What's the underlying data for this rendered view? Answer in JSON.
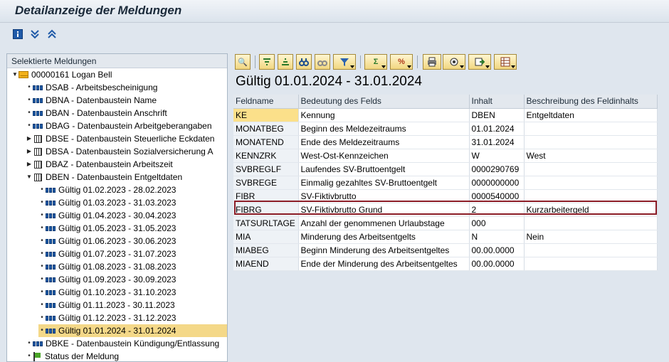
{
  "window": {
    "title": "Detailanzeige der Meldungen"
  },
  "app_toolbar": {
    "icons": [
      "info-icon",
      "expand-all-icon",
      "collapse-all-icon"
    ]
  },
  "tree": {
    "header": "Selektierte Meldungen",
    "root": "00000161 Logan Bell",
    "items": [
      {
        "label": "DSAB - Arbeitsbescheinigung",
        "icon": "record-icon"
      },
      {
        "label": "DBNA - Datenbaustein Name",
        "icon": "record-icon"
      },
      {
        "label": "DBAN - Datenbaustein Anschrift",
        "icon": "record-icon"
      },
      {
        "label": "DBAG - Datenbaustein Arbeitgeberangaben",
        "icon": "record-icon"
      },
      {
        "label": "DBSE - Datenbaustein Steuerliche Eckdaten",
        "icon": "table-icon"
      },
      {
        "label": "DBSA - Datenbaustein Sozialversicherung A",
        "icon": "table-icon"
      },
      {
        "label": "DBAZ - Datenbaustein Arbeitszeit",
        "icon": "table-icon"
      },
      {
        "label": "DBEN - Datenbaustein Entgeltdaten",
        "icon": "table-icon"
      }
    ],
    "periods": [
      "Gültig 01.02.2023 - 28.02.2023",
      "Gültig 01.03.2023 - 31.03.2023",
      "Gültig 01.04.2023 - 30.04.2023",
      "Gültig 01.05.2023 - 31.05.2023",
      "Gültig 01.06.2023 - 30.06.2023",
      "Gültig 01.07.2023 - 31.07.2023",
      "Gültig 01.08.2023 - 31.08.2023",
      "Gültig 01.09.2023 - 30.09.2023",
      "Gültig 01.10.2023 - 31.10.2023",
      "Gültig 01.11.2023 - 30.11.2023",
      "Gültig 01.12.2023 - 31.12.2023",
      "Gültig 01.01.2024 - 31.01.2024"
    ],
    "after": [
      {
        "label": "DBKE - Datenbaustein Kündigung/Entlassung",
        "icon": "record-icon"
      },
      {
        "label": "Status der Meldung",
        "icon": "flag-icon"
      }
    ],
    "selected_period": "Gültig 01.01.2024 - 31.01.2024"
  },
  "detail": {
    "title": "Gültig 01.01.2024 - 31.01.2024",
    "columns": [
      "Feldname",
      "Bedeutung des Felds",
      "Inhalt",
      "Beschreibung des Feldinhalts"
    ],
    "rows": [
      [
        "KE",
        "Kennung",
        "DBEN",
        "Entgeltdaten"
      ],
      [
        "MONATBEG",
        "Beginn des Meldezeitraums",
        "01.01.2024",
        ""
      ],
      [
        "MONATEND",
        "Ende des Meldezeitraums",
        "31.01.2024",
        ""
      ],
      [
        "KENNZRK",
        "West-Ost-Kennzeichen",
        "W",
        "West"
      ],
      [
        "SVBREGLF",
        "Laufendes SV-Bruttoentgelt",
        "0000290769",
        ""
      ],
      [
        "SVBREGE",
        "Einmalig gezahltes SV-Bruttoentgelt",
        "0000000000",
        ""
      ],
      [
        "FIBR",
        "SV-Fiktivbrutto",
        "0000540000",
        ""
      ],
      [
        "FIBRG",
        "SV-Fiktivbrutto Grund",
        "2",
        "Kurzarbeitergeld"
      ],
      [
        "TATSURLTAGE",
        "Anzahl der genommenen Urlaubstage",
        "000",
        ""
      ],
      [
        "MIA",
        "Minderung des Arbeitsentgelts",
        "N",
        "Nein"
      ],
      [
        "MIABEG",
        "Beginn Minderung des Arbeitsentgeltes",
        "00.00.0000",
        ""
      ],
      [
        "MIAEND",
        "Ende der Minderung des Arbeitsentgeltes",
        "00.00.0000",
        ""
      ]
    ],
    "highlighted_row": "FIBRG",
    "toolbar_icons": [
      "details-icon",
      "sort-ascending-icon",
      "sort-descending-icon",
      "find-icon",
      "find-next-icon",
      "filter-icon",
      "sum-icon",
      "subtotal-icon",
      "print-icon",
      "view-icon",
      "export-icon",
      "layout-icon"
    ]
  }
}
